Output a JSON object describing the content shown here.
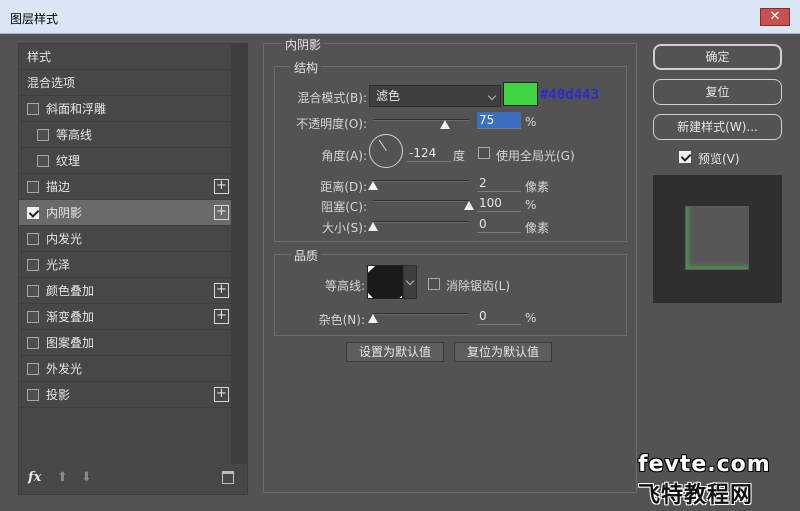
{
  "window": {
    "title": "图层样式",
    "close_glyph": "✕"
  },
  "sidebar": {
    "header": "样式",
    "blend_options": "混合选项",
    "items": [
      {
        "label": "斜面和浮雕",
        "checked": false,
        "plus": false,
        "indent": false
      },
      {
        "label": "等高线",
        "checked": false,
        "plus": false,
        "indent": true
      },
      {
        "label": "纹理",
        "checked": false,
        "plus": false,
        "indent": true
      },
      {
        "label": "描边",
        "checked": false,
        "plus": true,
        "indent": false
      },
      {
        "label": "内阴影",
        "checked": true,
        "plus": true,
        "indent": false,
        "selected": true
      },
      {
        "label": "内发光",
        "checked": false,
        "plus": false,
        "indent": false
      },
      {
        "label": "光泽",
        "checked": false,
        "plus": false,
        "indent": false
      },
      {
        "label": "颜色叠加",
        "checked": false,
        "plus": true,
        "indent": false
      },
      {
        "label": "渐变叠加",
        "checked": false,
        "plus": true,
        "indent": false
      },
      {
        "label": "图案叠加",
        "checked": false,
        "plus": false,
        "indent": false
      },
      {
        "label": "外发光",
        "checked": false,
        "plus": false,
        "indent": false
      },
      {
        "label": "投影",
        "checked": false,
        "plus": true,
        "indent": false
      }
    ],
    "plus_glyph": "+",
    "footer": {
      "fx": "fx",
      "up": "⬆",
      "down": "⬇"
    }
  },
  "inner_shadow": {
    "section_title": "内阴影",
    "structure": {
      "title": "结构",
      "blend_mode_label": "混合模式(B):",
      "blend_mode_value": "滤色",
      "color_hex": "#40d443",
      "color_swatch": "#40d443",
      "opacity_label": "不透明度(O):",
      "opacity_value": "75",
      "opacity_unit": "%",
      "opacity_fraction": 0.75,
      "angle_label": "角度(A):",
      "angle_value": "-124",
      "angle_unit": "度",
      "global_light_label": "使用全局光(G)",
      "global_light_checked": false,
      "distance_label": "距离(D):",
      "distance_value": "2",
      "distance_unit": "像素",
      "distance_fraction": 0.0,
      "choke_label": "阻塞(C):",
      "choke_value": "100",
      "choke_unit": "%",
      "choke_fraction": 1.0,
      "size_label": "大小(S):",
      "size_value": "0",
      "size_unit": "像素",
      "size_fraction": 0.0
    },
    "quality": {
      "title": "品质",
      "contour_label": "等高线:",
      "antialias_label": "消除锯齿(L)",
      "antialias_checked": false,
      "noise_label": "杂色(N):",
      "noise_value": "0",
      "noise_unit": "%",
      "noise_fraction": 0.0
    },
    "make_default": "设置为默认值",
    "reset_default": "复位为默认值"
  },
  "actions": {
    "ok": "确定",
    "reset": "复位",
    "new_style": "新建样式(W)...",
    "preview_label": "预览(V)",
    "preview_checked": true
  },
  "watermark": {
    "line1": "fevte.com",
    "line2": "飞特教程网"
  }
}
